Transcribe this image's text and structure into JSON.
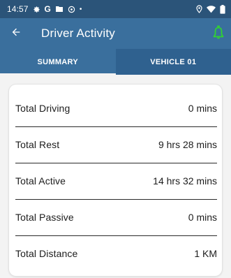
{
  "status_bar": {
    "time": "14:57",
    "left_icons": [
      "gear-icon",
      "google-g-icon",
      "folder-icon",
      "shield-cog-icon",
      "dot-icon"
    ],
    "right_icons": [
      "location-icon",
      "wifi-icon",
      "battery-icon"
    ],
    "google_letter": "G",
    "dot": "•"
  },
  "app_bar": {
    "title": "Driver Activity",
    "back_icon": "arrow-left-icon",
    "action_icon": "bell-icon",
    "action_color": "#31d331"
  },
  "tabs": [
    {
      "label": "SUMMARY",
      "active": true
    },
    {
      "label": "VEHICLE 01",
      "active": false
    }
  ],
  "summary": {
    "rows": [
      {
        "label": "Total Driving",
        "value": "0 mins"
      },
      {
        "label": "Total Rest",
        "value": "9 hrs 28 mins"
      },
      {
        "label": "Total Active",
        "value": "14 hrs 32 mins"
      },
      {
        "label": "Total Passive",
        "value": "0 mins"
      },
      {
        "label": "Total Distance",
        "value": "1 KM"
      }
    ]
  },
  "colors": {
    "status_bar": "#2b5479",
    "app_bar": "#3a6f9d",
    "inactive_tab": "#2f618f",
    "background": "#f3f3f3"
  }
}
